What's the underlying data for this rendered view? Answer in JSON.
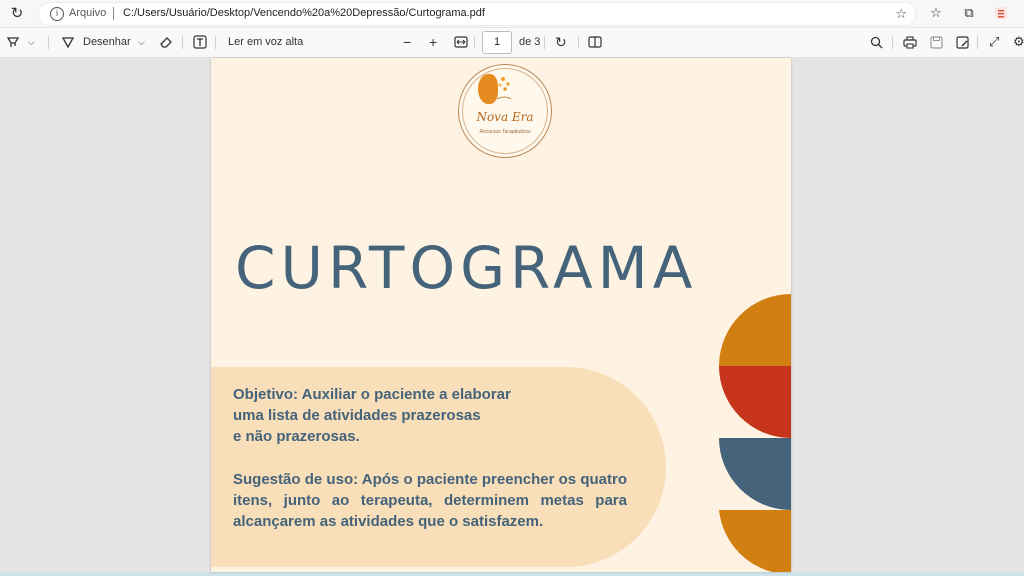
{
  "browser": {
    "address_scheme": "Arquivo",
    "url": "C:/Users/Usuário/Desktop/Vencendo%20a%20Depressão/Curtograma.pdf"
  },
  "pdf_toolbar": {
    "draw_label": "Desenhar",
    "read_aloud_label": "Ler em voz alta",
    "page_current": "1",
    "page_total": "de 3"
  },
  "document": {
    "logo_name": "Nova Era",
    "logo_subtitle": "Recursos Terapêuticos",
    "title": "CURTOGRAMA",
    "objective": "Objetivo: Auxiliar o paciente a elaborar\numa lista de atividades prazerosas\ne não prazerosas.",
    "suggestion": "Sugestão de uso: Após o paciente preencher os quatro itens, junto ao terapeuta, determinem metas para alcançarem as atividades que o satisfazem."
  },
  "colors": {
    "title": "#45637a",
    "page_bg": "#fef3e2",
    "blob": "#f8dfba",
    "orange": "#d27f12",
    "red": "#c7351c",
    "slate": "#45637a"
  },
  "icons": {
    "reload": "reload-icon",
    "info": "info-icon",
    "favorites_add": "star-plus-icon",
    "favorites": "favorites-icon",
    "collections": "collections-icon",
    "extension": "extension-icon"
  }
}
